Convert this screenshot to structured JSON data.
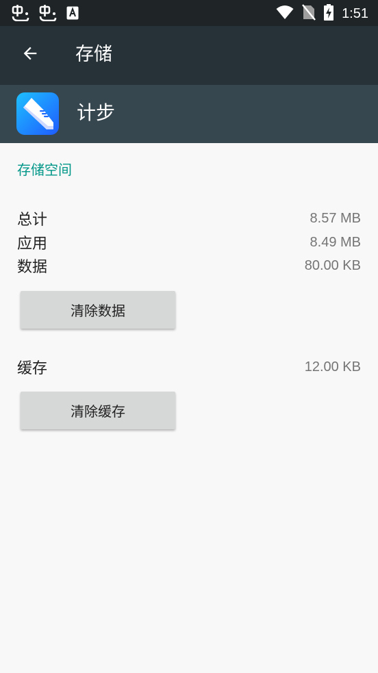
{
  "status_bar": {
    "time": "1:51",
    "left_icons": [
      "app-notification-icon",
      "app-notification-icon",
      "a-notification-icon"
    ],
    "right_icons": [
      "wifi-icon",
      "no-sim-icon",
      "battery-charging-icon"
    ]
  },
  "toolbar": {
    "title": "存储",
    "back_icon": "arrow-back-icon"
  },
  "app": {
    "name": "计步",
    "icon": "shoe-icon"
  },
  "storage": {
    "section_title": "存储空间",
    "rows": [
      {
        "label": "总计",
        "value": "8.57 MB"
      },
      {
        "label": "应用",
        "value": "8.49 MB"
      },
      {
        "label": "数据",
        "value": "80.00 KB"
      }
    ],
    "clear_data_label": "清除数据",
    "cache": {
      "label": "缓存",
      "value": "12.00 KB"
    },
    "clear_cache_label": "清除缓存"
  },
  "colors": {
    "status_bar": "#1f2427",
    "toolbar": "#263238",
    "app_header": "#37474f",
    "accent": "#009688",
    "background": "#f8f8f8",
    "button": "#d6d7d7"
  }
}
